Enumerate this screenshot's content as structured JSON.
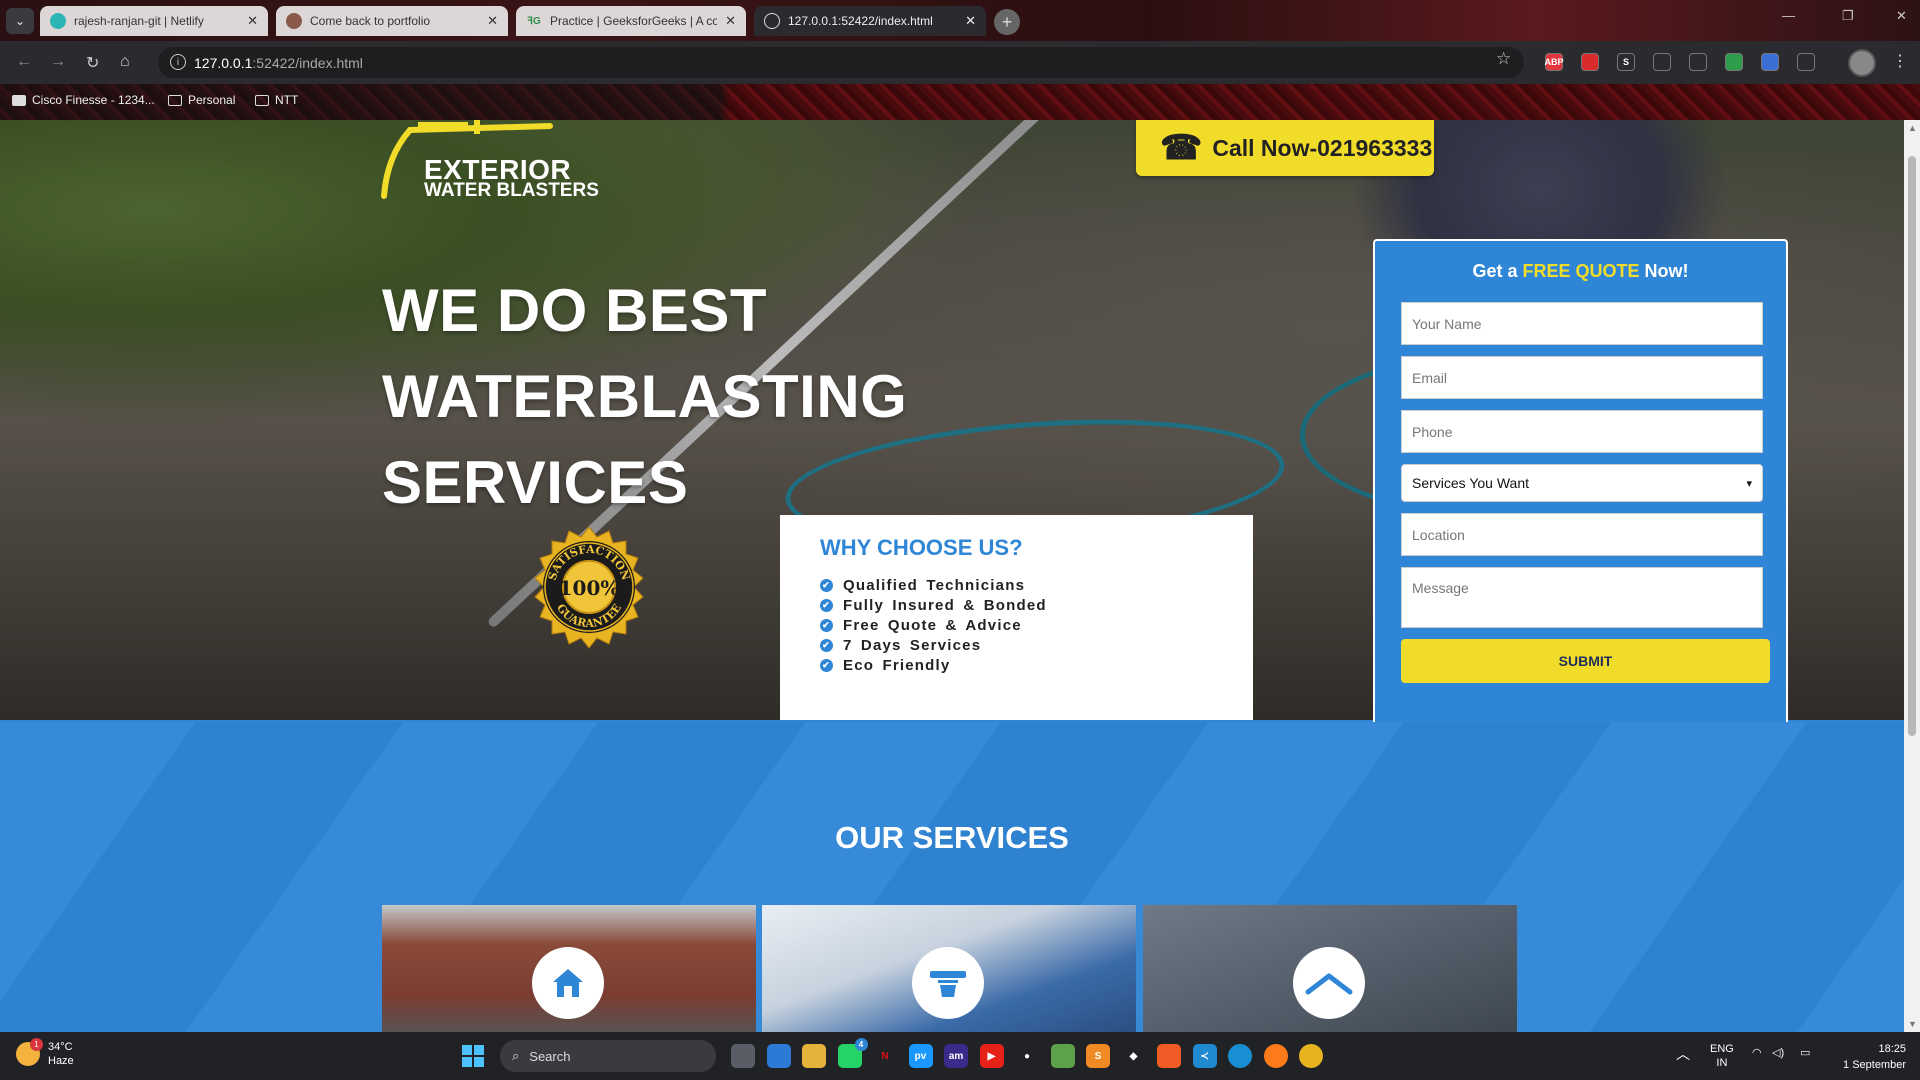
{
  "browser": {
    "tabs": [
      {
        "title": "rajesh-ranjan-git | Netlify",
        "favicon": "netlify-icon",
        "active": false
      },
      {
        "title": "Come back to portfolio",
        "favicon": "avatar-icon",
        "active": false
      },
      {
        "title": "Practice | GeeksforGeeks | A com",
        "favicon": "gfg-icon",
        "active": false
      },
      {
        "title": "127.0.0.1:52422/index.html",
        "favicon": "globe-icon",
        "active": true
      }
    ],
    "address": {
      "host": "127.0.0.1",
      "path": ":52422/index.html"
    },
    "bookmarks": [
      {
        "label": "Cisco Finesse - 1234...",
        "icon": "cisco-icon"
      },
      {
        "label": "Personal",
        "icon": "folder-icon"
      },
      {
        "label": "NTT",
        "icon": "folder-icon"
      }
    ],
    "extensions": [
      {
        "name": "adblock-icon",
        "label": "ABP",
        "color": "#e2353c"
      },
      {
        "name": "shield-ext-icon",
        "label": "",
        "color": "#d92b2b"
      },
      {
        "name": "s-ext-icon",
        "label": "S",
        "color": "#2b2b2f"
      },
      {
        "name": "target-ext-icon",
        "label": "",
        "color": "#2b2b2f"
      },
      {
        "name": "gear-ext-icon",
        "label": "",
        "color": "#2b2b2f"
      },
      {
        "name": "globe-ext-icon",
        "label": "",
        "color": "#2e9c4a"
      },
      {
        "name": "doc-ext-icon",
        "label": "",
        "color": "#3b6fd6"
      },
      {
        "name": "puzzle-icon",
        "label": "",
        "color": "#2b2b2f"
      }
    ]
  },
  "site": {
    "logo": {
      "line1": "EXTERIOR",
      "line2": "WATER BLASTERS"
    },
    "call_button": "Call Now-021963333",
    "headline": [
      "WE DO BEST",
      "WATERBLASTING",
      "SERVICES"
    ],
    "badge": {
      "top": "SATISFACTION",
      "center": "100%",
      "bottom": "GUARANTEE"
    },
    "why": {
      "title": "WHY CHOOSE US?",
      "items": [
        "Qualified Technicians",
        "Fully Insured & Bonded",
        "Free Quote & Advice",
        "7 Days Services",
        "Eco Friendly"
      ]
    },
    "quote": {
      "title_prefix": "Get a ",
      "title_highlight": "FREE QUOTE",
      "title_suffix": " Now!",
      "placeholders": {
        "name": "Your Name",
        "email": "Email",
        "phone": "Phone",
        "location": "Location",
        "message": "Message"
      },
      "service_select": "Services You Want",
      "submit": "SUBMIT"
    },
    "services": {
      "title": "OUR SERVICES",
      "cards": [
        {
          "icon": "house-icon"
        },
        {
          "icon": "squeegee-icon"
        },
        {
          "icon": "roof-icon"
        }
      ]
    },
    "colors": {
      "primary": "#2f86d6",
      "accent": "#f2dc2a",
      "dark_text": "#1f2f5a"
    }
  },
  "taskbar": {
    "weather": {
      "temp": "34°C",
      "condition": "Haze",
      "alerts": "1"
    },
    "search_placeholder": "Search",
    "apps": [
      "task-view-icon",
      "store-icon",
      "file-explorer-icon",
      "whatsapp-icon",
      "netflix-icon",
      "prime-video-icon",
      "amazon-music-icon",
      "youtube-icon",
      "github-icon",
      "notepad-icon",
      "sublime-icon",
      "mongodb-icon",
      "postman-icon",
      "vscode-icon",
      "edge-icon",
      "firefox-icon",
      "chrome-icon"
    ],
    "whatsapp_badge": "4",
    "language": {
      "line1": "ENG",
      "line2": "IN"
    },
    "clock": {
      "time": "18:25",
      "date": "1 September"
    }
  }
}
